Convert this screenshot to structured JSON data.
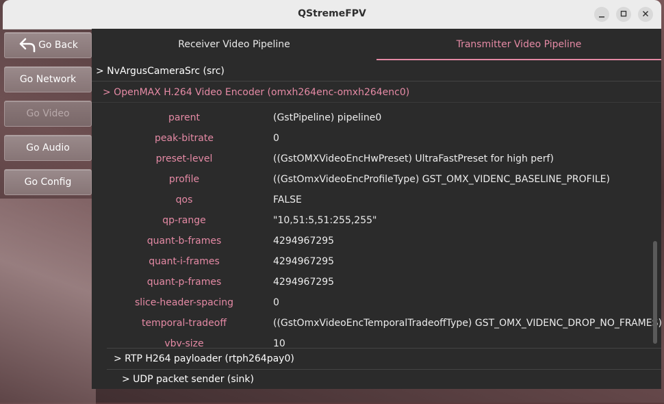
{
  "window": {
    "title": "QStremeFPV",
    "controls": [
      "minimize-icon",
      "maximize-icon",
      "close-icon"
    ]
  },
  "sidebar": {
    "items": [
      {
        "label": "Go Back",
        "icon": "back-arrow-icon",
        "enabled": true
      },
      {
        "label": "Go Network",
        "enabled": true
      },
      {
        "label": "Go Video",
        "enabled": false
      },
      {
        "label": "Go Audio",
        "enabled": true
      },
      {
        "label": "Go Config",
        "enabled": true
      }
    ]
  },
  "tabs": [
    {
      "label": "Receiver Video Pipeline",
      "active": false
    },
    {
      "label": "Transmitter Video Pipeline",
      "active": true
    }
  ],
  "pipeline": {
    "source": "> NvArgusCameraSrc (src)",
    "encoder": "> OpenMAX H.264 Video Encoder (omxh264enc-omxh264enc0)",
    "properties": [
      {
        "key": "parent",
        "value": "(GstPipeline) pipeline0"
      },
      {
        "key": "peak-bitrate",
        "value": "0"
      },
      {
        "key": "preset-level",
        "value": "((GstOMXVideoEncHwPreset) UltraFastPreset for high perf)"
      },
      {
        "key": "profile",
        "value": "((GstOmxVideoEncProfileType) GST_OMX_VIDENC_BASELINE_PROFILE)"
      },
      {
        "key": "qos",
        "value": "FALSE"
      },
      {
        "key": "qp-range",
        "value": "\"10,51:5,51:255,255\""
      },
      {
        "key": "quant-b-frames",
        "value": "4294967295"
      },
      {
        "key": "quant-i-frames",
        "value": "4294967295"
      },
      {
        "key": "quant-p-frames",
        "value": "4294967295"
      },
      {
        "key": "slice-header-spacing",
        "value": "0"
      },
      {
        "key": "temporal-tradeoff",
        "value": "((GstOmxVideoEncTemporalTradeoffType) GST_OMX_VIDENC_DROP_NO_FRAMES)"
      },
      {
        "key": "vbv-size",
        "value": "10"
      }
    ],
    "payloader": "> RTP H264 payloader (rtph264pay0)",
    "sink": "> UDP packet sender (sink)"
  },
  "colors": {
    "accent": "#e58aa5",
    "panel_bg": "#2b2b2b"
  }
}
